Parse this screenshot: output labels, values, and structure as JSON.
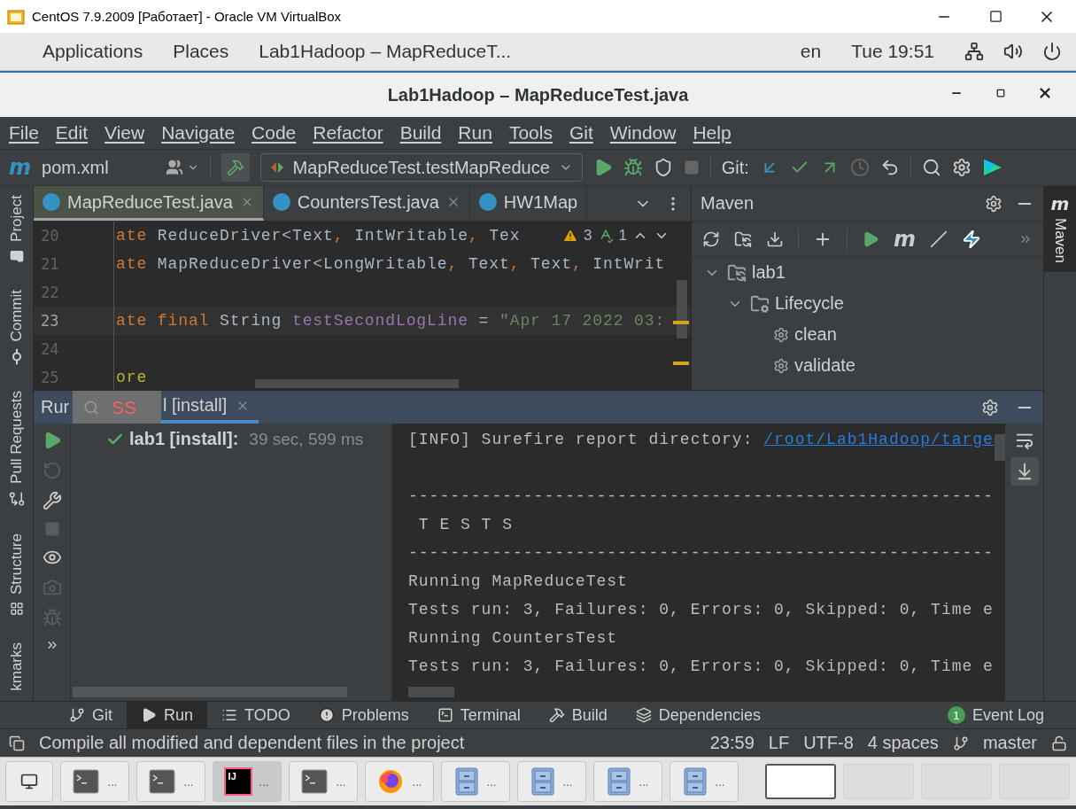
{
  "vm_window": {
    "title": "CentOS 7.9.2009 [Работает] - Oracle VM VirtualBox"
  },
  "top_bar": {
    "menus": [
      "Applications",
      "Places"
    ],
    "window_title": "Lab1Hadoop – MapReduceT...",
    "language": "en",
    "clock": "Tue 19:51"
  },
  "ide_window": {
    "title": "Lab1Hadoop – MapReduceTest.java"
  },
  "menu_bar": [
    "File",
    "Edit",
    "View",
    "Navigate",
    "Code",
    "Refactor",
    "Build",
    "Run",
    "Tools",
    "Git",
    "Window",
    "Help"
  ],
  "toolbar": {
    "file_glyph": "m",
    "project_file": "pom.xml",
    "run_config": "MapReduceTest.testMapReduce",
    "git_label": "Git:"
  },
  "left_stripe": [
    {
      "label": "Project",
      "kind": "project"
    },
    {
      "label": "Commit",
      "kind": "commit"
    },
    {
      "label": "Pull Requests",
      "kind": "pull"
    },
    {
      "label": "Structure",
      "kind": "structure"
    },
    {
      "label": "kmarks",
      "kind": "bookmarks"
    }
  ],
  "editor_tabs": [
    {
      "name": "MapReduceTest.java",
      "selected": true,
      "closable": true
    },
    {
      "name": "CountersTest.java",
      "selected": false,
      "closable": true
    },
    {
      "name": "HW1Map",
      "selected": false,
      "closable": false
    }
  ],
  "inspections": {
    "warnings": "3",
    "typos": "1"
  },
  "code_lines": [
    {
      "number": "20",
      "current": false,
      "tokens": [
        {
          "kind": "keyword",
          "text": "ate "
        },
        {
          "kind": "plain",
          "text": "ReduceDriver<Text"
        },
        {
          "kind": "keyword",
          "text": ", "
        },
        {
          "kind": "plain",
          "text": "IntWritable"
        },
        {
          "kind": "keyword",
          "text": ", "
        },
        {
          "kind": "plain",
          "text": "Tex"
        }
      ]
    },
    {
      "number": "21",
      "current": false,
      "tokens": [
        {
          "kind": "keyword",
          "text": "ate "
        },
        {
          "kind": "plain",
          "text": "MapReduceDriver<LongWritable"
        },
        {
          "kind": "keyword",
          "text": ", "
        },
        {
          "kind": "plain",
          "text": "Text"
        },
        {
          "kind": "keyword",
          "text": ", "
        },
        {
          "kind": "plain",
          "text": "Text"
        },
        {
          "kind": "keyword",
          "text": ", "
        },
        {
          "kind": "plain",
          "text": "IntWrit"
        }
      ]
    },
    {
      "number": "22",
      "current": false
    },
    {
      "number": "23",
      "current": true,
      "tokens": [
        {
          "kind": "keyword",
          "text": "ate final "
        },
        {
          "kind": "plain",
          "text": "String "
        },
        {
          "kind": "field",
          "text": "testSecondLogLine"
        },
        {
          "kind": "plain",
          "text": " = "
        },
        {
          "kind": "string",
          "text": "\"Apr 17 2022 03:"
        }
      ]
    },
    {
      "number": "24",
      "current": false
    },
    {
      "number": "25",
      "current": false,
      "tokens": [
        {
          "kind": "annotation",
          "text": "ore"
        }
      ]
    }
  ],
  "maven": {
    "title": "Maven",
    "glyph": "m",
    "tree": [
      {
        "label": "lab1",
        "kind": "project",
        "expanded": true,
        "children": [
          {
            "label": "Lifecycle",
            "kind": "folder",
            "expanded": true,
            "children": [
              {
                "label": "clean",
                "kind": "goal"
              },
              {
                "label": "validate",
                "kind": "goal"
              }
            ]
          }
        ]
      }
    ]
  },
  "right_stripe": [
    {
      "label": "Maven",
      "glyph": "m",
      "selected": true
    }
  ],
  "run_panel": {
    "title": "Rur",
    "search_text": "SS",
    "tabs": [
      {
        "label": "l [install]",
        "selected": true
      }
    ],
    "tree": [
      {
        "label": "lab1 [install]:",
        "time": "39 sec, 599 ms",
        "passed": true
      }
    ],
    "console": [
      {
        "kind": "text",
        "text": "[INFO] Surefire report directory: ",
        "link": "/root/Lab1Hadoop/targe"
      },
      {
        "kind": "blank"
      },
      {
        "kind": "text",
        "text": "--------------------------------------------------------"
      },
      {
        "kind": "text",
        "text": " T E S T S"
      },
      {
        "kind": "text",
        "text": "--------------------------------------------------------"
      },
      {
        "kind": "text",
        "text": "Running MapReduceTest"
      },
      {
        "kind": "text",
        "text": "Tests run: 3, Failures: 0, Errors: 0, Skipped: 0, Time e"
      },
      {
        "kind": "text",
        "text": "Running CountersTest"
      },
      {
        "kind": "text",
        "text": "Tests run: 3, Failures: 0, Errors: 0, Skipped: 0, Time e"
      }
    ]
  },
  "bottom_tabs": [
    {
      "label": "Git",
      "kind": "git",
      "selected": false
    },
    {
      "label": "Run",
      "kind": "run",
      "selected": true
    },
    {
      "label": "TODO",
      "kind": "todo",
      "selected": false
    },
    {
      "label": "Problems",
      "kind": "problems",
      "selected": false
    },
    {
      "label": "Terminal",
      "kind": "terminal",
      "selected": false
    },
    {
      "label": "Build",
      "kind": "build",
      "selected": false
    },
    {
      "label": "Dependencies",
      "kind": "dependencies",
      "selected": false
    }
  ],
  "event_log": {
    "label": "Event Log",
    "count": "1"
  },
  "status_bar": {
    "message": "Compile all modified and dependent files in the project",
    "position": "23:59",
    "line_separator": "LF",
    "encoding": "UTF-8",
    "indent": "4 spaces",
    "branch": "master"
  },
  "taskbar": {
    "windows": [
      {
        "kind": "terminal",
        "label": "...",
        "selected": false
      },
      {
        "kind": "terminal",
        "label": "...",
        "selected": false
      },
      {
        "kind": "ide",
        "label": "...",
        "logo_text": "IJ",
        "selected": true
      },
      {
        "kind": "terminal",
        "label": "...",
        "selected": false
      },
      {
        "kind": "browser",
        "label": "...",
        "selected": false
      },
      {
        "kind": "cabinet",
        "label": "...",
        "selected": false
      },
      {
        "kind": "cabinet",
        "label": "...",
        "selected": false
      },
      {
        "kind": "cabinet",
        "label": "...",
        "selected": false
      },
      {
        "kind": "cabinet",
        "label": "...",
        "selected": false
      }
    ],
    "workspaces": [
      {
        "selected": true
      },
      {
        "selected": false
      },
      {
        "selected": false
      },
      {
        "selected": false
      }
    ]
  }
}
